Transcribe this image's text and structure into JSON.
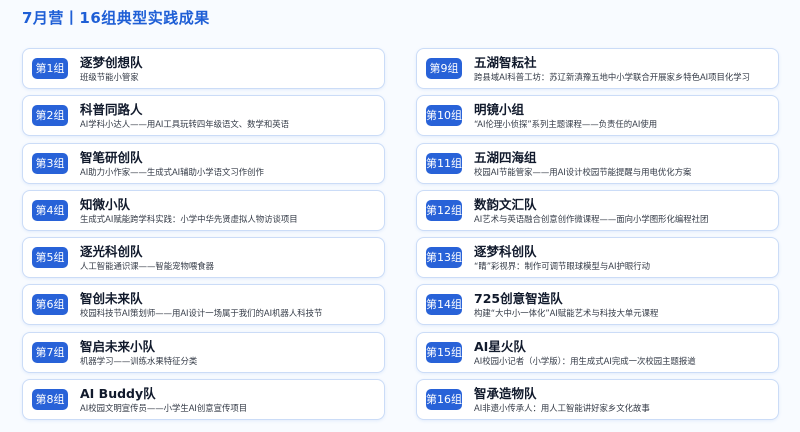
{
  "title": "7月营丨16组典型实践成果",
  "groups_left": [
    {
      "badge": "第1组",
      "team": "逐梦创想队",
      "desc": "班级节能小管家"
    },
    {
      "badge": "第2组",
      "team": "科普同路人",
      "desc": "AI学科小达人——用AI工具玩转四年级语文、数学和英语"
    },
    {
      "badge": "第3组",
      "team": "智笔研创队",
      "desc": "AI助力小作家——生成式AI辅助小学语文习作创作"
    },
    {
      "badge": "第4组",
      "team": "知微小队",
      "desc": "生成式AI赋能跨学科实践：小学中华先贤虚拟人物访谈项目"
    },
    {
      "badge": "第5组",
      "team": "逐光科创队",
      "desc": "人工智能通识课——智能宠物喂食器"
    },
    {
      "badge": "第6组",
      "team": "智创未来队",
      "desc": "校园科技节AI策划师——用AI设计一场属于我们的AI机器人科技节"
    },
    {
      "badge": "第7组",
      "team": "智启未来小队",
      "desc": "机器学习——训练水果特征分类"
    },
    {
      "badge": "第8组",
      "team": "AI Buddy队",
      "desc": "AI校园文明宣传员——小学生AI创意宣传项目"
    }
  ],
  "groups_right": [
    {
      "badge": "第9组",
      "team": "五湖智耘社",
      "desc": "跨县域AI科普工坊：苏辽新滇豫五地中小学联合开展家乡特色AI项目化学习"
    },
    {
      "badge": "第10组",
      "team": "明镜小组",
      "desc": "“AI伦理小侦探”系列主题课程——负责任的AI使用"
    },
    {
      "badge": "第11组",
      "team": "五湖四海组",
      "desc": "校园AI节能管家——用AI设计校园节能提醒与用电优化方案"
    },
    {
      "badge": "第12组",
      "team": "数韵文汇队",
      "desc": "AI艺术与英语融合创意创作微课程——面向小学图形化编程社团"
    },
    {
      "badge": "第13组",
      "team": "逐梦科创队",
      "desc": "“睛”彩视界：制作可调节眼球模型与AI护眼行动"
    },
    {
      "badge": "第14组",
      "team": "725创意智造队",
      "desc": "构建“大中小一体化”AI赋能艺术与科技大单元课程"
    },
    {
      "badge": "第15组",
      "team": "AI星火队",
      "desc": "AI校园小记者（小学版）：用生成式AI完成一次校园主题报道"
    },
    {
      "badge": "第16组",
      "team": "智承造物队",
      "desc": "AI非遗小传承人：用人工智能讲好家乡文化故事"
    }
  ]
}
